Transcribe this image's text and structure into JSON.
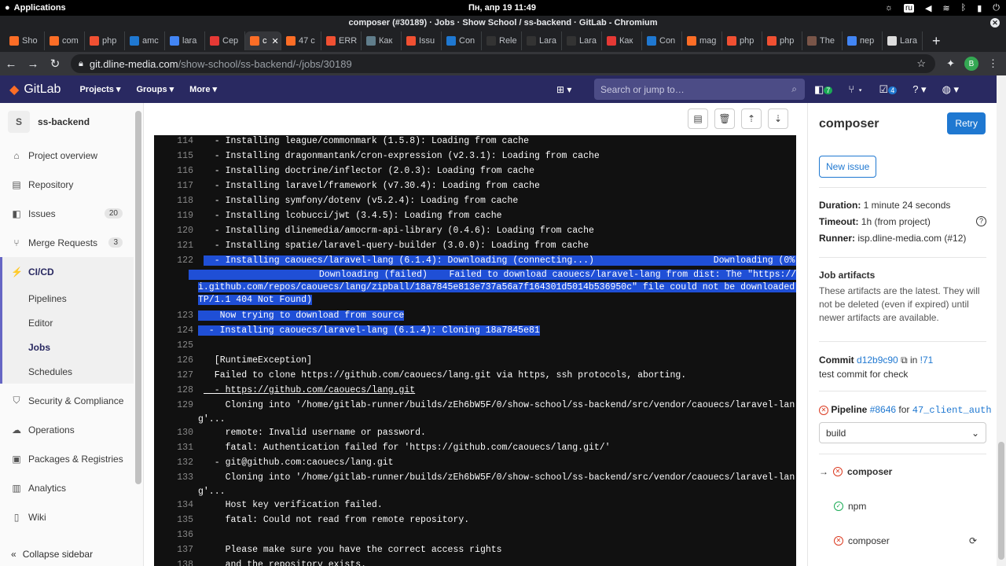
{
  "os": {
    "apps": "Applications",
    "clock": "Пн, апр 19   11:49",
    "lang": "ru"
  },
  "window": {
    "title": "composer (#30189) · Jobs · Show School / ss-backend · GitLab - Chromium"
  },
  "tabs": [
    {
      "label": "Sho",
      "color": "#fc6d26"
    },
    {
      "label": "com",
      "color": "#fc6d26"
    },
    {
      "label": "php",
      "color": "#f05032"
    },
    {
      "label": "amc",
      "color": "#1f78d1"
    },
    {
      "label": "lara",
      "color": "#4285f4"
    },
    {
      "label": "Сер",
      "color": "#e53935"
    },
    {
      "label": "c",
      "color": "#fc6d26"
    },
    {
      "label": "47 с",
      "color": "#fc6d26"
    },
    {
      "label": "ERR",
      "color": "#f05032"
    },
    {
      "label": "Как",
      "color": "#607d8b"
    },
    {
      "label": "Issu",
      "color": "#f05032"
    },
    {
      "label": "Con",
      "color": "#1f78d1"
    },
    {
      "label": "Rele",
      "color": "#333333"
    },
    {
      "label": "Lara",
      "color": "#333333"
    },
    {
      "label": "Lara",
      "color": "#333333"
    },
    {
      "label": "Как",
      "color": "#e53935"
    },
    {
      "label": "Con",
      "color": "#1f78d1"
    },
    {
      "label": "mag",
      "color": "#fc6d26"
    },
    {
      "label": "php",
      "color": "#f05032"
    },
    {
      "label": "php",
      "color": "#f05032"
    },
    {
      "label": "The",
      "color": "#795548"
    },
    {
      "label": "пер",
      "color": "#4285f4"
    },
    {
      "label": "Lara",
      "color": "#dddddd"
    }
  ],
  "address": {
    "host": "git.dline-media.com",
    "path": "/show-school/ss-backend/-/jobs/30189",
    "profile": "B"
  },
  "gitlab": {
    "brand": "GitLab",
    "menu": [
      "Projects ▾",
      "Groups ▾",
      "More ▾"
    ],
    "search_placeholder": "Search or jump to…",
    "todo_count": "7",
    "mr_count": "4"
  },
  "sidebar": {
    "project_avatar": "S",
    "project_name": "ss-backend",
    "items": [
      {
        "label": "Project overview",
        "icon": "⌂"
      },
      {
        "label": "Repository",
        "icon": "▤"
      },
      {
        "label": "Issues",
        "icon": "◧",
        "badge": "20"
      },
      {
        "label": "Merge Requests",
        "icon": "⑂",
        "badge": "3"
      },
      {
        "label": "CI/CD",
        "icon": "⚡"
      }
    ],
    "sub": [
      "Pipelines",
      "Editor",
      "Jobs",
      "Schedules"
    ],
    "items2": [
      {
        "label": "Security & Compliance",
        "icon": "⛉"
      },
      {
        "label": "Operations",
        "icon": "☁"
      },
      {
        "label": "Packages & Registries",
        "icon": "▣"
      },
      {
        "label": "Analytics",
        "icon": "▥"
      },
      {
        "label": "Wiki",
        "icon": "▯"
      }
    ],
    "collapse": "Collapse sidebar"
  },
  "log": [
    {
      "n": "114",
      "t": "  - Installing league/commonmark (1.5.8): Loading from cache"
    },
    {
      "n": "115",
      "t": "  - Installing dragonmantank/cron-expression (v2.3.1): Loading from cache"
    },
    {
      "n": "116",
      "t": "  - Installing doctrine/inflector (2.0.3): Loading from cache"
    },
    {
      "n": "117",
      "t": "  - Installing laravel/framework (v7.30.4): Loading from cache"
    },
    {
      "n": "118",
      "t": "  - Installing symfony/dotenv (v5.2.4): Loading from cache"
    },
    {
      "n": "119",
      "t": "  - Installing lcobucci/jwt (3.4.5): Loading from cache"
    },
    {
      "n": "120",
      "t": "  - Installing dlinemedia/amocrm-api-library (0.4.6): Loading from cache"
    },
    {
      "n": "121",
      "t": "  - Installing spatie/laravel-query-builder (3.0.0): Loading from cache"
    }
  ],
  "log_hl": {
    "n122": "122",
    "l122a": "  - Installing caouecs/laravel-lang (6.1.4): Downloading (connecting...)                      Downloading (0%)",
    "l122b": "                        Downloading (failed)    Failed to download caouecs/laravel-lang from dist: The \"https://ap",
    "l122c": "i.github.com/repos/caouecs/lang/zipball/18a7845e813e737a56a7f164301d5014b536950c\" file could not be downloaded (HT",
    "l122d": "TP/1.1 404 Not Found)",
    "n123": "123",
    "l123": "    Now trying to download from source",
    "n124": "124",
    "l124": "  - Installing caouecs/laravel-lang (6.1.4): Cloning 18a7845e81"
  },
  "log2": [
    {
      "n": "125",
      "t": ""
    },
    {
      "n": "126",
      "t": "  [RuntimeException]"
    },
    {
      "n": "127",
      "t": "  Failed to clone https://github.com/caouecs/lang.git via https, ssh protocols, aborting."
    },
    {
      "n": "128",
      "t": "  - https://github.com/caouecs/lang.git"
    },
    {
      "n": "129",
      "t": "    Cloning into '/home/gitlab-runner/builds/zEh6bW5F/0/show-school/ss-backend/src/vendor/caouecs/laravel-lan",
      "w": "g'..."
    },
    {
      "n": "130",
      "t": "    remote: Invalid username or password."
    },
    {
      "n": "131",
      "t": "    fatal: Authentication failed for 'https://github.com/caouecs/lang.git/'"
    },
    {
      "n": "132",
      "t": "  - git@github.com:caouecs/lang.git"
    },
    {
      "n": "133",
      "t": "    Cloning into '/home/gitlab-runner/builds/zEh6bW5F/0/show-school/ss-backend/src/vendor/caouecs/laravel-lan",
      "w": "g'..."
    },
    {
      "n": "134",
      "t": "    Host key verification failed."
    },
    {
      "n": "135",
      "t": "    fatal: Could not read from remote repository."
    },
    {
      "n": "136",
      "t": ""
    },
    {
      "n": "137",
      "t": "    Please make sure you have the correct access rights"
    },
    {
      "n": "138",
      "t": "    and the repository exists."
    }
  ],
  "right": {
    "title": "composer",
    "retry": "Retry",
    "new_issue": "New issue",
    "duration_k": "Duration:",
    "duration_v": " 1 minute 24 seconds",
    "timeout_k": "Timeout:",
    "timeout_v": " 1h (from project)",
    "runner_k": "Runner:",
    "runner_v": " isp.dline-media.com (#12)",
    "artifacts_title": "Job artifacts",
    "artifacts_desc": "These artifacts are the latest. They will not be deleted (even if expired) until newer artifacts are available.",
    "commit_k": "Commit",
    "commit_sha": "d12b9c90",
    "commit_in": " in ",
    "commit_mr": "!71",
    "commit_msg": "test commit for check",
    "pipeline_k": "Pipeline",
    "pipeline_id": "#8646",
    "pipeline_for": " for ",
    "pipeline_branch": "47_client_auth",
    "stage": "build",
    "jobs": [
      "composer",
      "npm",
      "composer"
    ]
  }
}
